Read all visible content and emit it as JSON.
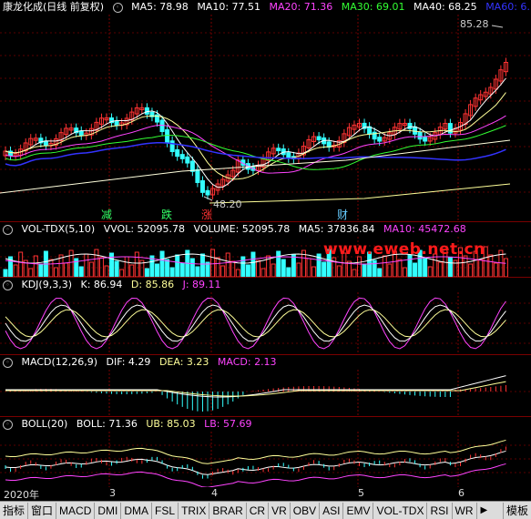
{
  "main": {
    "title": "康龙化成(日线 前复权)",
    "ma": [
      {
        "label": "MA5: 78.98",
        "color": "#ffffff"
      },
      {
        "label": "MA10: 77.51",
        "color": "#ffffff"
      },
      {
        "label": "MA20: 71.36",
        "color": "#ff44ff"
      },
      {
        "label": "MA30: 69.01",
        "color": "#33ff33"
      },
      {
        "label": "MA40: 68.25",
        "color": "#ffffff"
      },
      {
        "label": "MA60: 6…",
        "color": "#3333ff"
      }
    ],
    "high_label": "85.28",
    "low_label": "48.20",
    "events": [
      {
        "text": "减",
        "color": "#33ff66"
      },
      {
        "text": "跌",
        "color": "#33ff66"
      },
      {
        "text": "涨",
        "color": "#ff3333"
      },
      {
        "text": "财",
        "color": "#66ccff"
      }
    ]
  },
  "volume": {
    "name": "VOL-TDX(5,10)",
    "vvol": "VVOL: 52095.78",
    "volume": "VOLUME: 52095.78",
    "ma5": "MA5: 37836.84",
    "ma10": "MA10: 45472.68",
    "colors": {
      "name": "#ffffff",
      "vvol": "#ffffff",
      "volume": "#ffffff",
      "ma5": "#ffffff",
      "ma10": "#ff44ff"
    }
  },
  "watermark": "www.eweb.net.cn",
  "kdj": {
    "name": "KDJ(9,3,3)",
    "k": "K: 86.94",
    "d": "D: 85.86",
    "j": "J: 89.11"
  },
  "macd": {
    "name": "MACD(12,26,9)",
    "dif": "DIF: 4.29",
    "dea": "DEA: 3.23",
    "macd": "MACD: 2.13"
  },
  "boll": {
    "name": "BOLL(20)",
    "boll": "BOLL: 71.36",
    "ub": "UB: 85.03",
    "lb": "LB: 57.69"
  },
  "xaxis": {
    "labels": [
      "2020年",
      "3",
      "4",
      "5",
      "6"
    ]
  },
  "tabs": [
    "指标",
    "窗口",
    "MACD",
    "DMI",
    "DMA",
    "FSL",
    "TRIX",
    "BRAR",
    "CR",
    "VR",
    "OBV",
    "ASI",
    "EMV",
    "VOL-TDX",
    "RSI",
    "WR"
  ],
  "right_tab": "模板",
  "colors": {
    "up": "#ff3333",
    "down": "#33ffff",
    "grid": "#7a0000",
    "magenta": "#ff44ff",
    "green": "#33ff33",
    "blue": "#3333ff",
    "yellow": "#ffff99"
  }
}
